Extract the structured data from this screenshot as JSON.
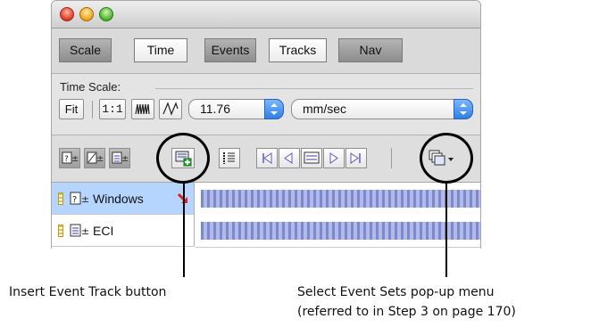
{
  "nav_tabs": [
    {
      "label": "Scale",
      "active": true
    },
    {
      "label": "Time",
      "active": false
    },
    {
      "label": "Events",
      "active": true
    },
    {
      "label": "Tracks",
      "active": false
    },
    {
      "label": "Nav",
      "active": true
    }
  ],
  "time_scale": {
    "label": "Time Scale:",
    "fit_label": "Fit",
    "one_to_one_label": "1:1",
    "value": "11.76",
    "unit": "mm/sec"
  },
  "tracks": [
    {
      "name": "Windows",
      "selected": true
    },
    {
      "name": "ECI",
      "selected": false
    }
  ],
  "callouts": {
    "insert_event_track": "Insert Event Track button",
    "select_event_sets_line1": "Select Event Sets pop-up menu",
    "select_event_sets_line2": "(referred to in Step 3 on page 170)"
  },
  "colors": {
    "selection": "#b5d5ff",
    "popup_arrow": "#2f7fe6",
    "event_stripes": "#5a64be",
    "marker_red": "#d81e1e"
  }
}
